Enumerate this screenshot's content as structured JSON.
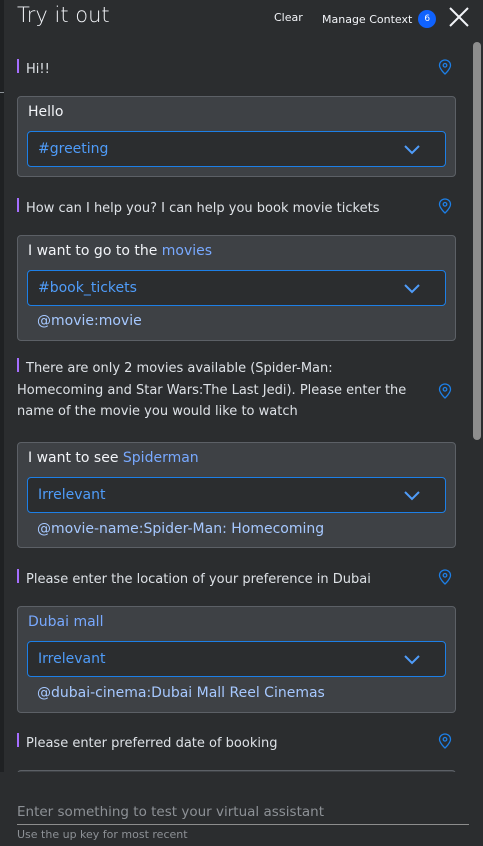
{
  "header": {
    "title": "Try it out",
    "clear_label": "Clear",
    "manage_context_label": "Manage Context",
    "context_count": "6"
  },
  "conversation": {
    "bot_1": "Hi!!",
    "user_1": {
      "text": "Hello",
      "intent": "#greeting"
    },
    "bot_2": "How can I help you? I can help you book movie tickets",
    "user_2": {
      "text_before": "I want to go to the ",
      "highlight": "movies",
      "intent": "#book_tickets",
      "entity": "@movie:movie"
    },
    "bot_3": "There are only 2 movies available (Spider-Man: Homecoming and Star Wars:The Last Jedi). Please enter the name of the movie you would like to watch",
    "user_3": {
      "text_before": "I want to see ",
      "highlight": "Spiderman",
      "intent": "Irrelevant",
      "entity": "@movie-name:Spider-Man: Homecoming"
    },
    "bot_4": "Please enter the location of your preference in Dubai",
    "user_4": {
      "text": "Dubai mall",
      "intent": "Irrelevant",
      "entity": "@dubai-cinema:Dubai Mall Reel Cinemas"
    },
    "bot_5": "Please enter preferred date of booking"
  },
  "input": {
    "placeholder": "Enter something to test your virtual assistant",
    "hint": "Use the up key for most recent"
  },
  "colors": {
    "accent": "#0f62fe",
    "intent_border": "#1d7fe6",
    "entity_text": "#a6c8ff",
    "bot_bar": "#a56eff",
    "background": "#2b2d2f",
    "card": "#3e4145"
  }
}
